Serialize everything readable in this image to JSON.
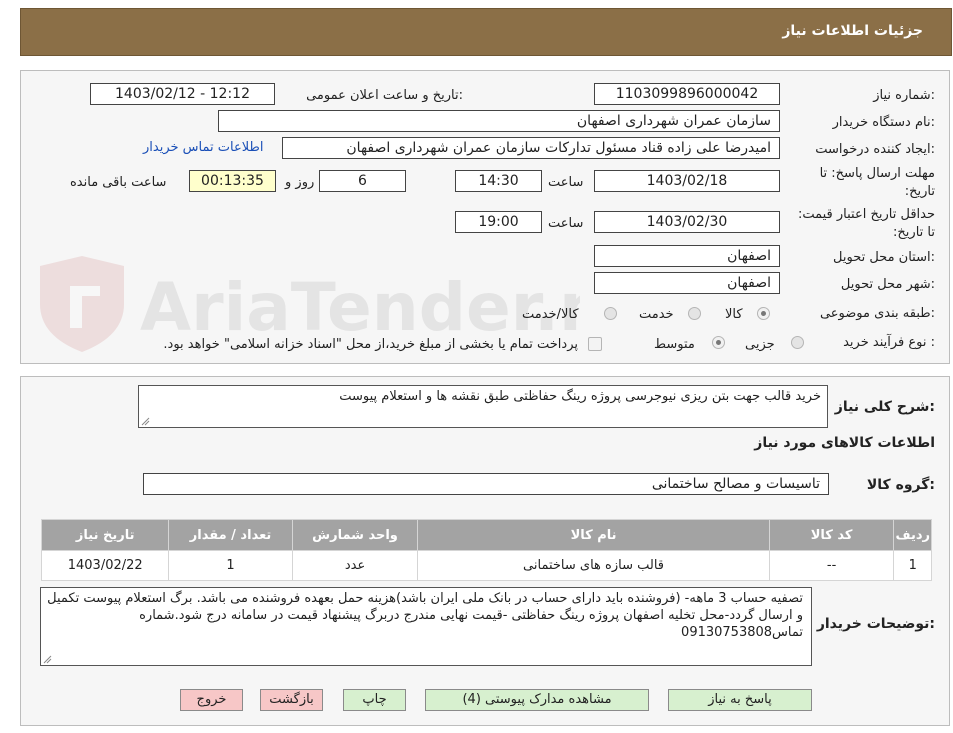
{
  "header": {
    "title": "جزئیات اطلاعات نیاز"
  },
  "form": {
    "need_number_label": "شماره نیاز:",
    "need_number": "1103099896000042",
    "announce_label": "تاریخ و ساعت اعلان عمومی:",
    "announce_value": "1403/02/12 - 12:12",
    "buyer_org_label": "نام دستگاه خریدار:",
    "buyer_org": "سازمان عمران شهرداری اصفهان",
    "requester_label": "ایجاد کننده درخواست:",
    "requester": "امیدرضا علی زاده قناد مسئول تدارکات سازمان عمران شهرداری اصفهان",
    "contact_link": "اطلاعات تماس خریدار",
    "deadline_label": "مهلت ارسال پاسخ: تا تاریخ:",
    "deadline_date": "1403/02/18",
    "hour_label": "ساعت",
    "deadline_time": "14:30",
    "days_value": "6",
    "days_label": "روز و",
    "remaining_time": "00:13:35",
    "remaining_label": "ساعت باقی مانده",
    "validity_label": "حداقل تاریخ اعتبار قیمت: تا تاریخ:",
    "validity_date": "1403/02/30",
    "validity_time": "19:00",
    "province_label": "استان محل تحویل:",
    "province": "اصفهان",
    "city_label": "شهر محل تحویل:",
    "city": "اصفهان",
    "category_label": "طبقه بندی موضوعی:",
    "category_options": [
      "کالا",
      "خدمت",
      "کالا/خدمت"
    ],
    "process_label": "نوع فرآیند خرید :",
    "process_options": [
      "جزیی",
      "متوسط"
    ],
    "payment_note": "پرداخت تمام یا بخشی از مبلغ خرید،از محل \"اسناد خزانه اسلامی\" خواهد بود."
  },
  "summary": {
    "general_label": "شرح کلی نیاز:",
    "general_text": "خرید قالب جهت بتن ریزی نیوجرسی پروژه رینگ حفاظتی طبق نقشه ها و استعلام پیوست",
    "goods_info_title": "اطلاعات کالاهای مورد نیاز",
    "goods_group_label": "گروه کالا:",
    "goods_group": "تاسیسات و مصالح ساختمانی"
  },
  "table": {
    "headers": [
      "ردیف",
      "کد کالا",
      "نام کالا",
      "واحد شمارش",
      "تعداد / مقدار",
      "تاریخ نیاز"
    ],
    "rows": [
      [
        "1",
        "--",
        "قالب سازه های ساختمانی",
        "عدد",
        "1",
        "1403/02/22"
      ]
    ]
  },
  "notes": {
    "label": "توضیحات خریدار:",
    "text": "تصفیه حساب 3 ماهه- (فروشنده باید دارای حساب در بانک ملی ایران باشد)هزینه حمل بعهده فروشنده می باشد. برگ استعلام پیوست تکمیل و ارسال گردد-محل تخلیه اصفهان پروژه رینگ حفاظتی -قیمت نهایی مندرج دربرگ پیشنهاد قیمت در سامانه درج شود.شماره تماس09130753808"
  },
  "buttons": {
    "reply": "پاسخ به نیاز",
    "attachments": "مشاهده مدارک پیوستی (4)",
    "print": "چاپ",
    "back": "بازگشت",
    "exit": "خروج"
  },
  "watermark": {
    "text": "AriaTender.neT"
  },
  "colors": {
    "header_bg": "#8b6f47",
    "table_header_bg": "#a3a3a3",
    "highlight_box": "#ffffcc",
    "button_green": "#d7f0cf",
    "button_red": "#f7c7c7",
    "link": "#1a4fb7"
  }
}
